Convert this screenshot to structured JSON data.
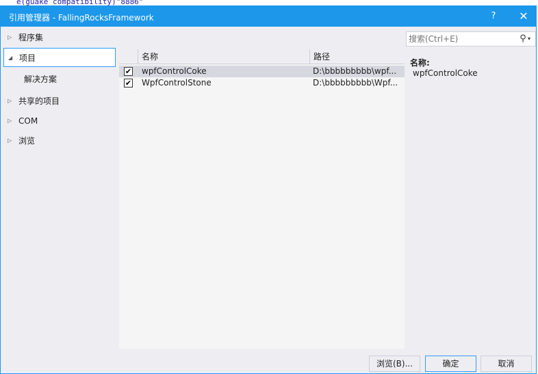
{
  "background_code": "e(guake_compatibility)\"8886\"",
  "window": {
    "title": "引用管理器 - FallingRocksFramework",
    "help_label": "?",
    "close_label": "✕"
  },
  "nav": {
    "items": [
      {
        "label": "程序集",
        "arrow": "▷"
      },
      {
        "label": "项目",
        "arrow": "◢"
      },
      {
        "label": "解决方案",
        "arrow": ""
      },
      {
        "label": "共享的项目",
        "arrow": "▷"
      },
      {
        "label": "COM",
        "arrow": "▷"
      },
      {
        "label": "浏览",
        "arrow": "▷"
      }
    ]
  },
  "table": {
    "columns": [
      "",
      "名称",
      "路径"
    ],
    "rows": [
      {
        "checked": "✔",
        "name": "wpfControlCoke",
        "path": "D:\\bbbbbbbbb\\wpf..."
      },
      {
        "checked": "✔",
        "name": "WpfControlStone",
        "path": "D:\\bbbbbbbbb\\Wpf..."
      }
    ]
  },
  "search": {
    "placeholder": "搜索(Ctrl+E)",
    "icon": "⚲",
    "dropdown_icon": "▾"
  },
  "details": {
    "label": "名称:",
    "value": "wpfControlCoke"
  },
  "buttons": {
    "browse": "浏览(B)...",
    "ok": "确定",
    "cancel": "取消"
  },
  "colors": {
    "accent": "#1c97ea",
    "selected_border": "#3399ff",
    "row_selected": "#d6d7df"
  }
}
